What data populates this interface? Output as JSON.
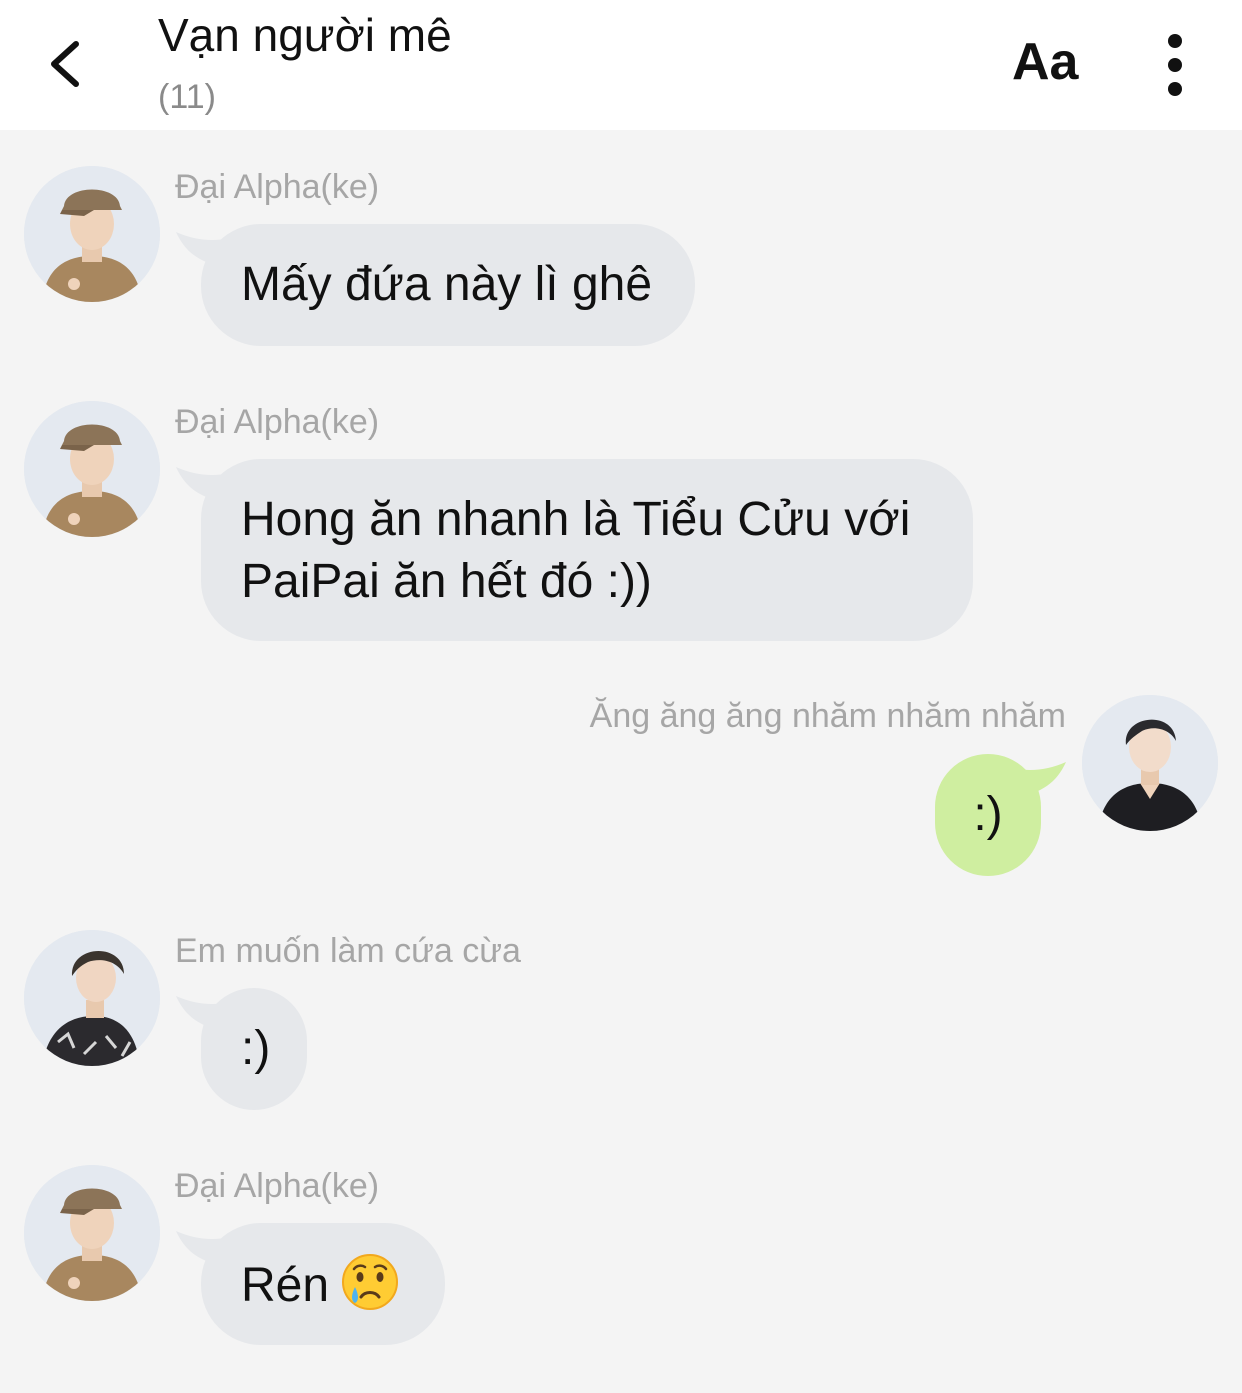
{
  "header": {
    "title": "Vạn người mê",
    "member_count": "(11)",
    "back_icon": "chevron-left-icon",
    "font_button_label": "Aa",
    "more_icon": "more-vertical-icon"
  },
  "colors": {
    "incoming_bubble": "#e6e8eb",
    "outgoing_bubble": "#cfeea0",
    "background": "#f4f4f4",
    "sender_name": "#a6a6a6"
  },
  "messages": [
    {
      "sender": "Đại Alpha(ke)",
      "direction": "incoming",
      "text": "Mấy đứa này lì ghê"
    },
    {
      "sender": "Đại Alpha(ke)",
      "direction": "incoming",
      "text": "Hong ăn nhanh là Tiểu Cửu với\nPaiPai ăn hết đó :))"
    },
    {
      "sender": "Ăng ăng ăng nhăm nhăm nhăm",
      "direction": "outgoing",
      "text": ":)"
    },
    {
      "sender": "Em muốn làm cứa cừa",
      "direction": "incoming",
      "text": ":)"
    },
    {
      "sender": "Đại Alpha(ke)",
      "direction": "incoming",
      "text": "Rén",
      "emoji": "crying-face-emoji"
    }
  ]
}
